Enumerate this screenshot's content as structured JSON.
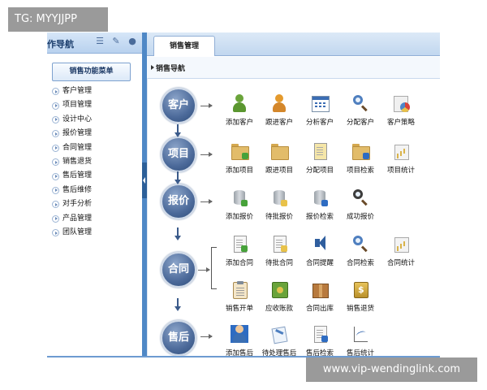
{
  "watermarks": {
    "top": "TG: MYYJJPP",
    "bottom": "www.vip-wendinglink.com"
  },
  "sidebar": {
    "title": "作导航",
    "tools": [
      "list-icon",
      "wrench-icon",
      "user-icon"
    ],
    "menu_button": "销售功能菜单",
    "items": [
      {
        "label": "客户管理"
      },
      {
        "label": "项目管理"
      },
      {
        "label": "设计中心"
      },
      {
        "label": "报价管理"
      },
      {
        "label": "合同管理"
      },
      {
        "label": "销售退货"
      },
      {
        "label": "售后管理"
      },
      {
        "label": "售后维修"
      },
      {
        "label": "对手分析"
      },
      {
        "label": "产品管理"
      },
      {
        "label": "团队管理"
      }
    ]
  },
  "main": {
    "tab": "销售管理",
    "nav_title": "销售导航",
    "stages": [
      {
        "label": "客户",
        "actions": [
          {
            "label": "添加客户",
            "icon": "person-add-icon"
          },
          {
            "label": "跟进客户",
            "icon": "person-follow-icon"
          },
          {
            "label": "分析客户",
            "icon": "calendar-analysis-icon"
          },
          {
            "label": "分配客户",
            "icon": "search-assign-icon"
          },
          {
            "label": "客户策略",
            "icon": "pie-strategy-icon"
          }
        ]
      },
      {
        "label": "项目",
        "actions": [
          {
            "label": "添加项目",
            "icon": "folder-add-icon"
          },
          {
            "label": "跟进项目",
            "icon": "folder-follow-icon"
          },
          {
            "label": "分配项目",
            "icon": "document-assign-icon"
          },
          {
            "label": "项目检索",
            "icon": "folder-search-icon"
          },
          {
            "label": "项目统计",
            "icon": "folder-chart-icon"
          }
        ]
      },
      {
        "label": "报价",
        "actions": [
          {
            "label": "添加报价",
            "icon": "database-add-icon"
          },
          {
            "label": "待批报价",
            "icon": "database-pending-icon"
          },
          {
            "label": "报价检索",
            "icon": "database-search-icon"
          },
          {
            "label": "成功报价",
            "icon": "magnifier-success-icon"
          }
        ]
      },
      {
        "label": "合同",
        "actions_row1": [
          {
            "label": "添加合同",
            "icon": "document-add-icon"
          },
          {
            "label": "待批合同",
            "icon": "document-pending-icon"
          },
          {
            "label": "合同提醒",
            "icon": "speaker-reminder-icon"
          },
          {
            "label": "合同检索",
            "icon": "magnifier-icon"
          },
          {
            "label": "合同统计",
            "icon": "document-chart-icon"
          }
        ],
        "actions_row2": [
          {
            "label": "销售开单",
            "icon": "clipboard-icon"
          },
          {
            "label": "应收账款",
            "icon": "bill-icon"
          },
          {
            "label": "合同出库",
            "icon": "box-icon"
          },
          {
            "label": "销售退货",
            "icon": "money-bag-icon"
          }
        ]
      },
      {
        "label": "售后",
        "actions": [
          {
            "label": "添加售后",
            "icon": "technician-icon"
          },
          {
            "label": "待处理售后",
            "icon": "tools-icon"
          },
          {
            "label": "售后检索",
            "icon": "document-search-icon"
          },
          {
            "label": "售后统计",
            "icon": "graph-icon"
          }
        ]
      }
    ]
  }
}
